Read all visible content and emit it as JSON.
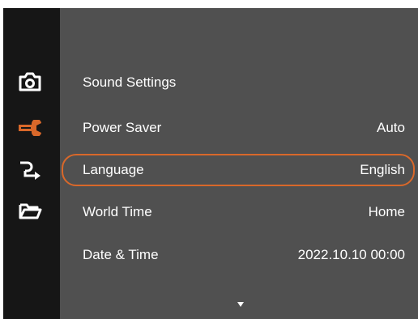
{
  "sidebar": {
    "icons": [
      {
        "name": "camera-icon",
        "color": "#ffffff"
      },
      {
        "name": "wrench-icon",
        "color": "#d9682a"
      },
      {
        "name": "transfer-arrow-icon",
        "color": "#ffffff"
      },
      {
        "name": "folder-icon",
        "color": "#ffffff"
      }
    ],
    "active_index": 1
  },
  "menu": {
    "items": [
      {
        "label": "Sound Settings",
        "value": ""
      },
      {
        "label": "Power Saver",
        "value": "Auto"
      },
      {
        "label": "Language",
        "value": "English"
      },
      {
        "label": "World Time",
        "value": "Home"
      },
      {
        "label": "Date & Time",
        "value": "2022.10.10 00:00"
      }
    ],
    "selected_index": 2,
    "more_below_icon": "down-triangle-icon"
  },
  "colors": {
    "accent": "#d9682a",
    "background": "#505050",
    "sidebar": "#161616",
    "text": "#ffffff"
  }
}
